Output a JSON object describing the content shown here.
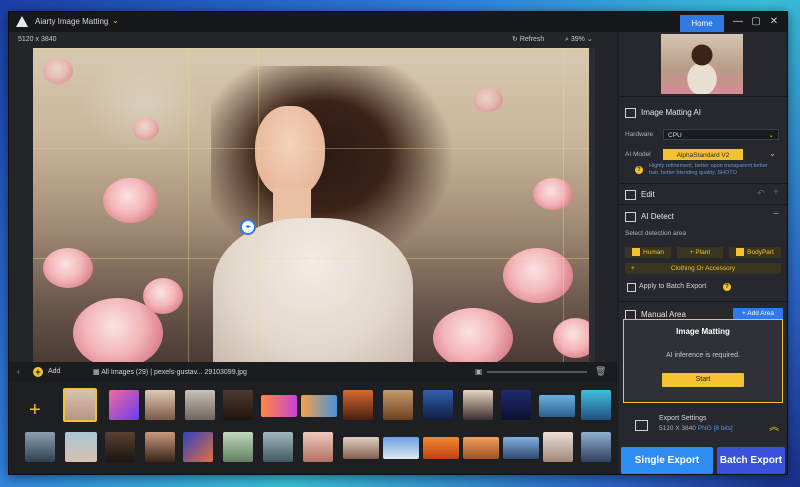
{
  "titlebar": {
    "title": "Aiarty Image Matting",
    "home_tab": "Home",
    "minimize": "—",
    "maximize": "▢",
    "close": "✕"
  },
  "canvas_toolbar": {
    "dimensions": "5120 x 3840",
    "refresh": "Refresh",
    "zoom": "39%"
  },
  "filmstrip": {
    "add": "Add",
    "all_images": "All Images (29)",
    "separator": "|",
    "filename": "pexels-gustav... 29103099.jpg"
  },
  "right": {
    "image_matting_ai": "Image Matting AI",
    "hardware_label": "Hardware",
    "hardware_value": "CPU",
    "ai_model_label": "AI Model",
    "ai_model_value": "AlphaStandard V2",
    "model_desc": "Highly refinement, better upon transparent better hair, better blending quality, SHOTO",
    "edit": "Edit",
    "ai_detect": "AI Detect",
    "detect_prompt": "Select detection area",
    "chips": [
      "Human",
      "Plant",
      "BodyPart"
    ],
    "chip_wide": "Clothing Or Accessory",
    "apply_batch": "Apply to Batch Export",
    "manual_area": "Manual Area",
    "add_area": "Add Area",
    "matting_title": "Image Matting",
    "matting_msg": "AI inference is required.",
    "start": "Start",
    "export_settings": "Export Settings",
    "export_res": "5120 X 3840",
    "export_format": "PNG",
    "export_size": "[8 bits]",
    "single_export": "Single Export",
    "batch_export": "Batch Export"
  },
  "colors": {
    "accent_yellow": "#f2c230",
    "accent_blue": "#2f7be6"
  }
}
